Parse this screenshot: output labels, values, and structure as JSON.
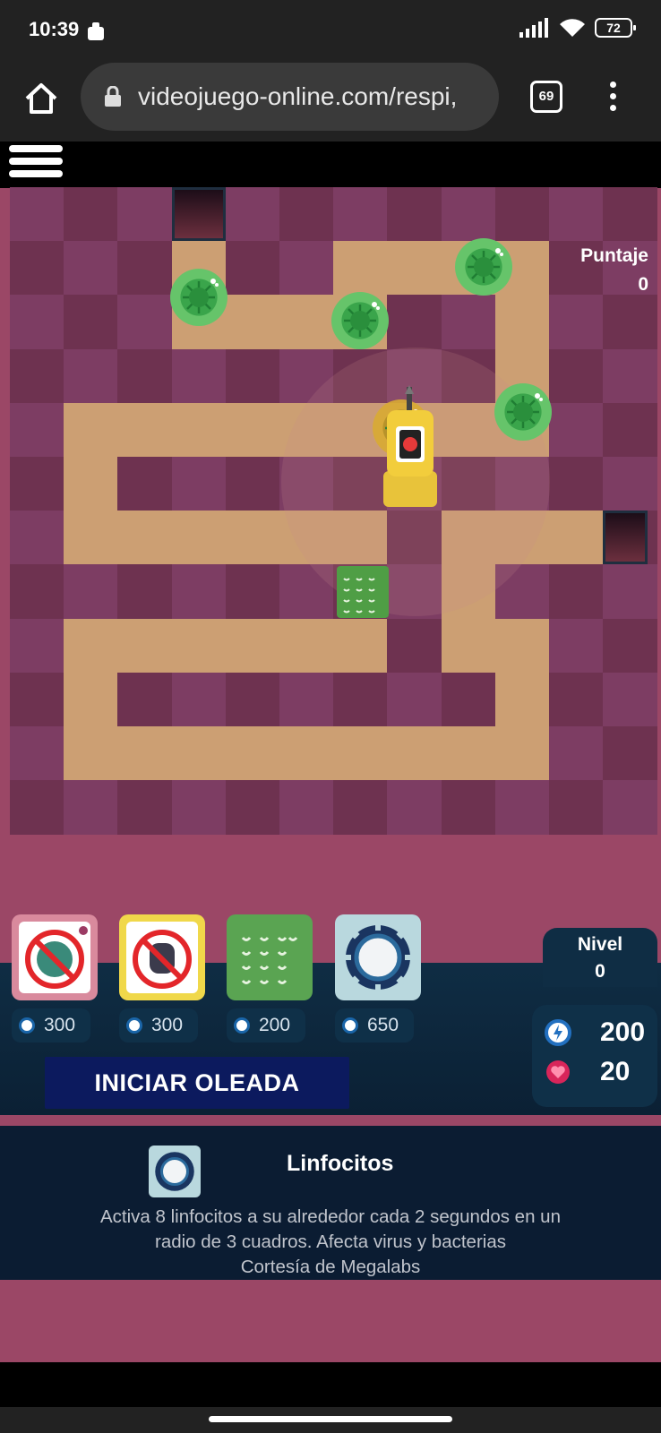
{
  "status_bar": {
    "time": "10:39",
    "battery": "72"
  },
  "browser": {
    "url": "videojuego-online.com/respi,",
    "tab_count": "69"
  },
  "hud": {
    "score_label": "Puntaje",
    "score_value": "0",
    "level_label": "Nivel",
    "level_value": "0",
    "energy": "200",
    "lives": "20"
  },
  "shop": {
    "items": [
      {
        "name": "antiviral-tower",
        "price": "300"
      },
      {
        "name": "antibacterial-tower",
        "price": "300"
      },
      {
        "name": "linfocitos-tile",
        "price": "200"
      },
      {
        "name": "macrophage-tower",
        "price": "650"
      }
    ],
    "start_wave": "INICIAR OLEADA"
  },
  "info_panel": {
    "title": "Linfocitos",
    "line1": "Activa 8 linfocitos a su alrededor cada 2 segundos en un",
    "line2": "radio de 3 cuadros. Afecta virus y bacterias",
    "line3": "Cortesía de Megalabs"
  },
  "colors": {
    "tile_a": "#7d3d63",
    "tile_b": "#6e3250",
    "path": "#cc9f73",
    "virus": "#3aa54b",
    "panel": "#0b1c32"
  }
}
